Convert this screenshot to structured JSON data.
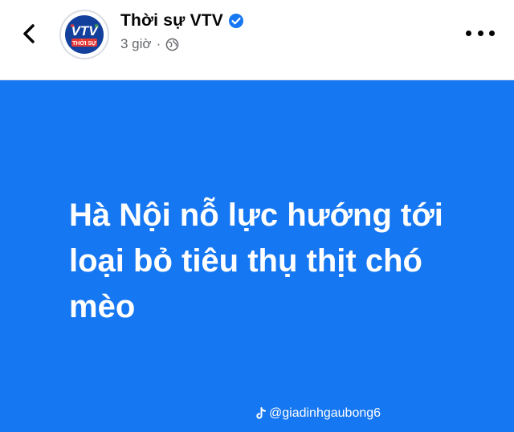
{
  "header": {
    "page_name": "Thời sự VTV",
    "time_ago": "3 giờ",
    "separator": "·",
    "logo": {
      "main": "VTV",
      "sub": "THỜI SỰ"
    }
  },
  "post": {
    "headline_lines": [
      "Hà Nội nỗ lực hướng tới",
      "loại bỏ tiêu thụ thịt chó",
      "mèo"
    ],
    "watermark": "@giadinhgaubong6",
    "background_color": "#1677f2"
  },
  "icons": {
    "back": "chevron-left-icon",
    "verified": "verified-badge-icon",
    "audience": "globe-icon",
    "more": "more-options-icon",
    "watermark": "tiktok-icon"
  },
  "colors": {
    "accent": "#1877f2",
    "text": "#050505",
    "muted": "#65676b"
  }
}
